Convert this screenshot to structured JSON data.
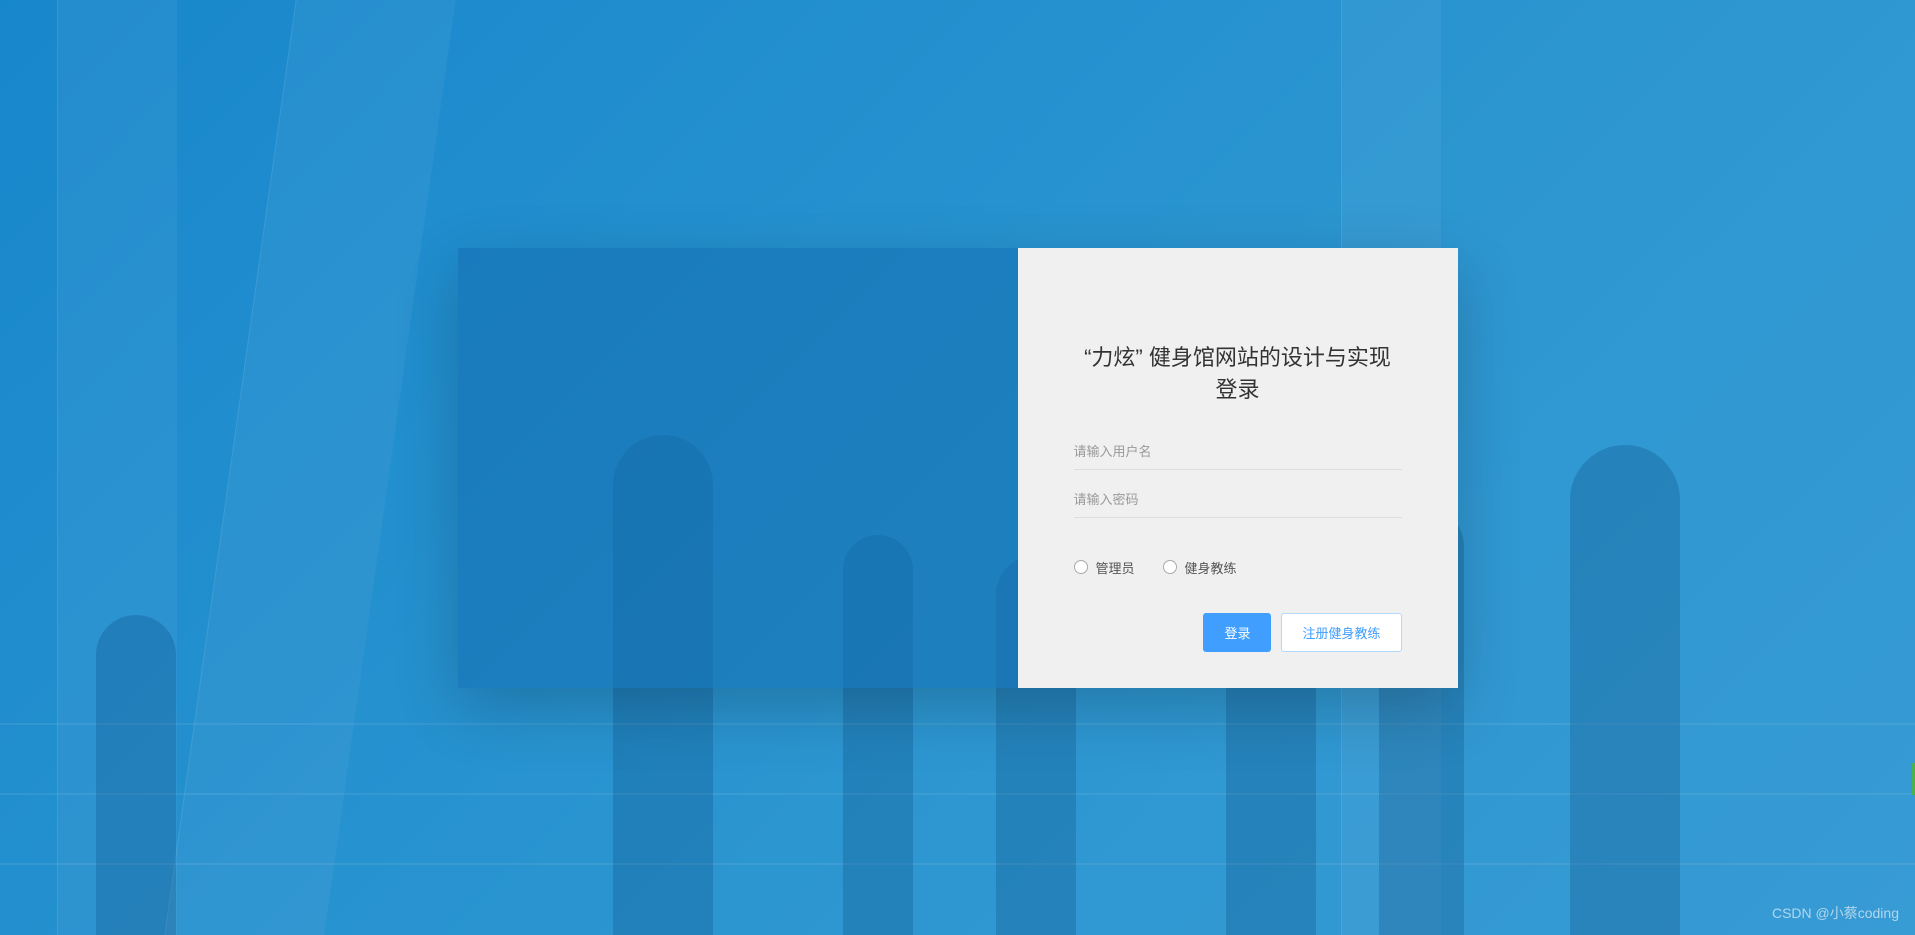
{
  "form": {
    "title": "“力炫” 健身馆网站的设计与实现 登录",
    "username_placeholder": "请输入用户名",
    "password_placeholder": "请输入密码",
    "roles": {
      "admin": "管理员",
      "coach": "健身教练"
    },
    "buttons": {
      "login": "登录",
      "register": "注册健身教练"
    }
  },
  "watermark": "CSDN @小蔡coding"
}
